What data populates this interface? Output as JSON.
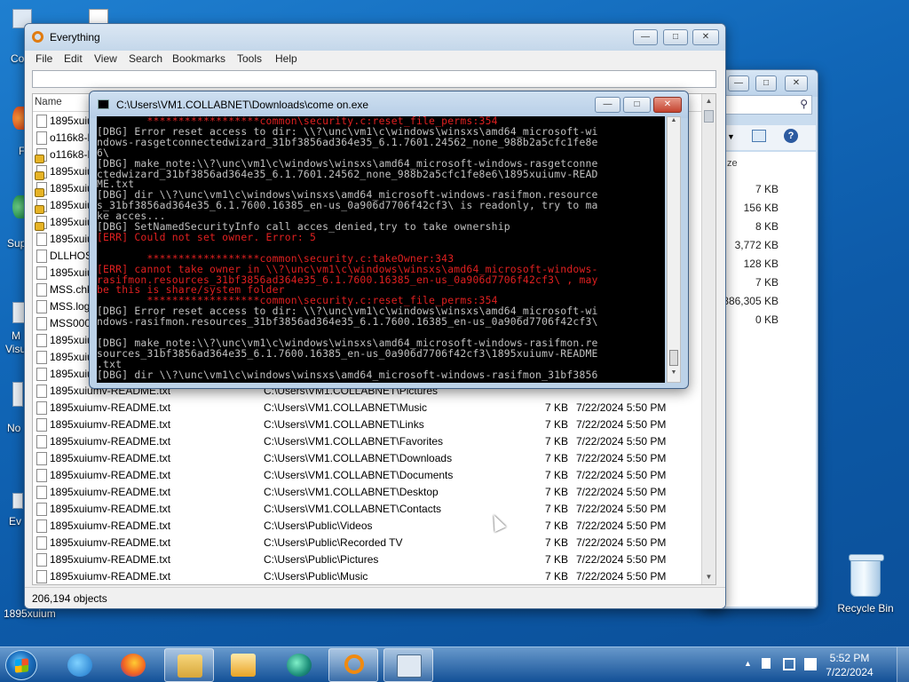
{
  "desktop": {
    "icons": [
      {
        "label": "Co"
      },
      {
        "label": "F"
      },
      {
        "label": "Sup"
      },
      {
        "label": "M"
      },
      {
        "label": "Visu"
      },
      {
        "label": "No"
      },
      {
        "label": "Ev"
      },
      {
        "label": "1895xuium"
      }
    ],
    "recycle_bin": "Recycle Bin"
  },
  "explorer_bg": {
    "sizes_header": "ze",
    "sizes": [
      "7 KB",
      "156 KB",
      "8 KB",
      "3,772 KB",
      "128 KB",
      "7 KB",
      "886,305 KB",
      "0 KB"
    ]
  },
  "everything": {
    "title": "Everything",
    "menu": [
      "File",
      "Edit",
      "View",
      "Search",
      "Bookmarks",
      "Tools",
      "Help"
    ],
    "search_value": "",
    "col_name": "Name",
    "top_rows": [
      {
        "name": "1895xuiu",
        "lock": false
      },
      {
        "name": "o116k8-R",
        "lock": false
      },
      {
        "name": "o116k8-R",
        "lock": true
      },
      {
        "name": "1895xuiu",
        "lock": true
      },
      {
        "name": "1895xuiu",
        "lock": true
      },
      {
        "name": "1895xuiu",
        "lock": true
      },
      {
        "name": "1895xuiu",
        "lock": true
      },
      {
        "name": "1895xuiu",
        "lock": false
      },
      {
        "name": "DLLHOS",
        "lock": false
      },
      {
        "name": "1895xuiu",
        "lock": false
      },
      {
        "name": "MSS.chk",
        "lock": false
      },
      {
        "name": "MSS.log",
        "lock": false
      },
      {
        "name": "MSS0001",
        "lock": false
      },
      {
        "name": "1895xuiu",
        "lock": false
      },
      {
        "name": "1895xuiu",
        "lock": false
      },
      {
        "name": "1895xuiu",
        "lock": false
      },
      {
        "name": "1895xuiumv-README.txt",
        "path": "C:\\Users\\VM1.COLLABNET\\Pictures"
      }
    ],
    "rows": [
      {
        "name": "1895xuiumv-README.txt",
        "path": "C:\\Users\\VM1.COLLABNET\\Music",
        "size": "7 KB",
        "date": "7/22/2024 5:50 PM"
      },
      {
        "name": "1895xuiumv-README.txt",
        "path": "C:\\Users\\VM1.COLLABNET\\Links",
        "size": "7 KB",
        "date": "7/22/2024 5:50 PM"
      },
      {
        "name": "1895xuiumv-README.txt",
        "path": "C:\\Users\\VM1.COLLABNET\\Favorites",
        "size": "7 KB",
        "date": "7/22/2024 5:50 PM"
      },
      {
        "name": "1895xuiumv-README.txt",
        "path": "C:\\Users\\VM1.COLLABNET\\Downloads",
        "size": "7 KB",
        "date": "7/22/2024 5:50 PM"
      },
      {
        "name": "1895xuiumv-README.txt",
        "path": "C:\\Users\\VM1.COLLABNET\\Documents",
        "size": "7 KB",
        "date": "7/22/2024 5:50 PM"
      },
      {
        "name": "1895xuiumv-README.txt",
        "path": "C:\\Users\\VM1.COLLABNET\\Desktop",
        "size": "7 KB",
        "date": "7/22/2024 5:50 PM"
      },
      {
        "name": "1895xuiumv-README.txt",
        "path": "C:\\Users\\VM1.COLLABNET\\Contacts",
        "size": "7 KB",
        "date": "7/22/2024 5:50 PM"
      },
      {
        "name": "1895xuiumv-README.txt",
        "path": "C:\\Users\\Public\\Videos",
        "size": "7 KB",
        "date": "7/22/2024 5:50 PM"
      },
      {
        "name": "1895xuiumv-README.txt",
        "path": "C:\\Users\\Public\\Recorded TV",
        "size": "7 KB",
        "date": "7/22/2024 5:50 PM"
      },
      {
        "name": "1895xuiumv-README.txt",
        "path": "C:\\Users\\Public\\Pictures",
        "size": "7 KB",
        "date": "7/22/2024 5:50 PM"
      },
      {
        "name": "1895xuiumv-README.txt",
        "path": "C:\\Users\\Public\\Music",
        "size": "7 KB",
        "date": "7/22/2024 5:50 PM"
      }
    ],
    "status": "206,194 objects"
  },
  "console": {
    "title": "C:\\Users\\VM1.COLLABNET\\Downloads\\come on.exe",
    "lines": [
      {
        "t": "err",
        "s": "        ******************common\\security.c:reset_file_perms:354"
      },
      {
        "t": "dbg",
        "s": "[DBG] Error reset access to dir: \\\\?\\unc\\vm1\\c\\windows\\winsxs\\amd64_microsoft-wi"
      },
      {
        "t": "dbg",
        "s": "ndows-rasgetconnectedwizard_31bf3856ad364e35_6.1.7601.24562_none_988b2a5cfc1fe8e"
      },
      {
        "t": "dbg",
        "s": "6\\"
      },
      {
        "t": "dbg",
        "s": "[DBG] make_note:\\\\?\\unc\\vm1\\c\\windows\\winsxs\\amd64_microsoft-windows-rasgetconne"
      },
      {
        "t": "dbg",
        "s": "ctedwizard_31bf3856ad364e35_6.1.7601.24562_none_988b2a5cfc1fe8e6\\1895xuiumv-READ"
      },
      {
        "t": "dbg",
        "s": "ME.txt"
      },
      {
        "t": "dbg",
        "s": "[DBG] dir \\\\?\\unc\\vm1\\c\\windows\\winsxs\\amd64_microsoft-windows-rasifmon.resource"
      },
      {
        "t": "dbg",
        "s": "s_31bf3856ad364e35_6.1.7600.16385_en-us_0a906d7706f42cf3\\ is readonly, try to ma"
      },
      {
        "t": "dbg",
        "s": "ke acces..."
      },
      {
        "t": "dbg",
        "s": "[DBG] SetNamedSecurityInfo call acces_denied,try to take ownership"
      },
      {
        "t": "err",
        "s": "[ERR] Could not set owner. Error: 5"
      },
      {
        "t": "blank",
        "s": ""
      },
      {
        "t": "err",
        "s": "        ******************common\\security.c:takeOwner:343"
      },
      {
        "t": "err",
        "s": "[ERR] cannot take owner in \\\\?\\unc\\vm1\\c\\windows\\winsxs\\amd64_microsoft-windows-"
      },
      {
        "t": "err",
        "s": "rasifmon.resources_31bf3856ad364e35_6.1.7600.16385_en-us_0a906d7706f42cf3\\ , may"
      },
      {
        "t": "err",
        "s": "be this is share/system folder"
      },
      {
        "t": "err",
        "s": "        ******************common\\security.c:reset_file_perms:354"
      },
      {
        "t": "dbg",
        "s": "[DBG] Error reset access to dir: \\\\?\\unc\\vm1\\c\\windows\\winsxs\\amd64_microsoft-wi"
      },
      {
        "t": "dbg",
        "s": "ndows-rasifmon.resources_31bf3856ad364e35_6.1.7600.16385_en-us_0a906d7706f42cf3\\"
      },
      {
        "t": "blank",
        "s": ""
      },
      {
        "t": "dbg",
        "s": "[DBG] make_note:\\\\?\\unc\\vm1\\c\\windows\\winsxs\\amd64_microsoft-windows-rasifmon.re"
      },
      {
        "t": "dbg",
        "s": "sources_31bf3856ad364e35_6.1.7600.16385_en-us_0a906d7706f42cf3\\1895xuiumv-README"
      },
      {
        "t": "dbg",
        "s": ".txt"
      },
      {
        "t": "dbg",
        "s": "[DBG] dir \\\\?\\unc\\vm1\\c\\windows\\winsxs\\amd64_microsoft-windows-rasifmon_31bf3856"
      }
    ]
  },
  "taskbar": {
    "apps": [
      {
        "icon": "internet-explorer-icon"
      },
      {
        "icon": "firefox-icon"
      },
      {
        "icon": "file-explorer-icon"
      },
      {
        "icon": "media-player-icon"
      },
      {
        "icon": "app-icon"
      },
      {
        "icon": "everything-search-icon"
      },
      {
        "icon": "console-icon"
      }
    ],
    "time": "5:52 PM",
    "date": "7/22/2024"
  }
}
